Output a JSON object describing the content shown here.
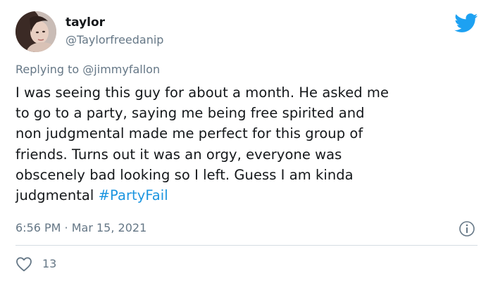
{
  "author": {
    "display_name": "taylor",
    "handle": "@Taylorfreedanip",
    "avatar_icon": "profile-photo"
  },
  "brand": {
    "icon": "twitter-bird-icon",
    "color": "#1da1f2"
  },
  "reply": {
    "prefix": "Replying to",
    "mention": "@jimmyfallon"
  },
  "tweet": {
    "text": "I was seeing this guy for about a month. He asked me\nto go to a party, saying me being free spirited  and\nnon judgmental made me perfect for this group of\nfriends. Turns out it was an orgy, everyone was\nobscenely bad looking so I left. Guess I am kinda\njudgmental ",
    "hashtag": "#PartyFail",
    "hashtag_color": "#1b95e0",
    "timestamp": "6:56 PM · Mar 15, 2021"
  },
  "actions": {
    "like_icon": "heart-icon",
    "like_count": "13",
    "info_icon": "info-icon"
  }
}
